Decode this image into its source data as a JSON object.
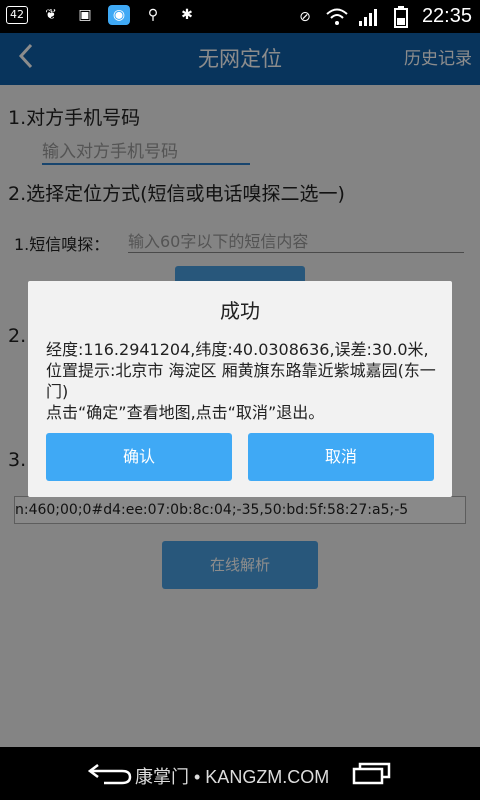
{
  "status_bar": {
    "badge": "42",
    "time": "22:35",
    "icons": [
      "leaf-icon",
      "image-icon",
      "app-icon",
      "usb-icon",
      "bug-icon",
      "mute-icon",
      "wifi-icon",
      "signal-icon",
      "battery-icon"
    ]
  },
  "app_bar": {
    "title": "无网定位",
    "history": "历史记录"
  },
  "form": {
    "step1": "1.对方手机号码",
    "phone_placeholder": "输入对方手机号码",
    "step2": "2.选择定位方式(短信或电话嗅探二选一)",
    "sms_label": "1.短信嗅探：",
    "sms_placeholder": "输入60字以下的短信内容",
    "step2_partial": "2.",
    "step3_partial": "3.",
    "data_text": "n:460;00;0#d4:ee:07:0b:8c:04;-35,50:bd:5f:58:27:a5;-5",
    "parse_button": "在线解析"
  },
  "dialog": {
    "title": "成功",
    "message": "经度:116.2941204,纬度:40.0308636,误差:30.0米,位置提示:北京市 海淀区 厢黄旗东路靠近紫城嘉园(东一门)",
    "message2": "点击“确定”查看地图,点击“取消”退出。",
    "confirm": "确认",
    "cancel": "取消"
  },
  "nav_bar": {
    "watermark": "康掌门 • KANGZM.COM"
  }
}
